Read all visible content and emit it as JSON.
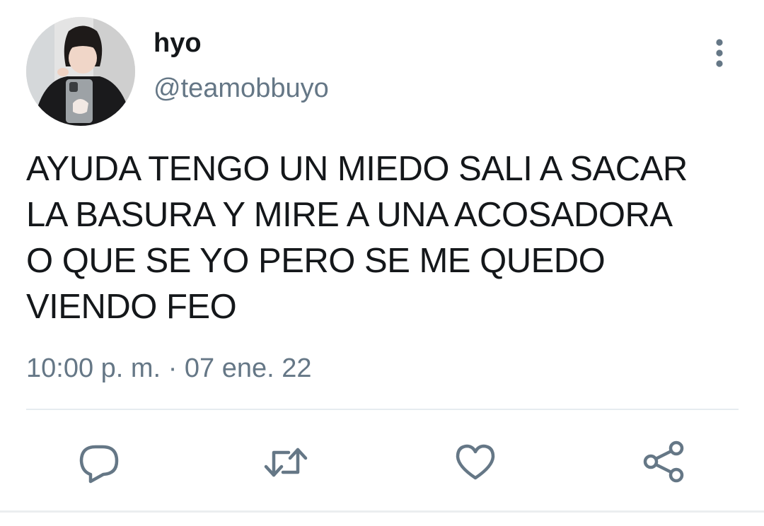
{
  "tweet": {
    "display_name": "hyo",
    "handle": "@teamobbuyo",
    "text": "AYUDA TENGO UN MIEDO SALI A SACAR\nLA BASURA Y MIRE A UNA ACOSADORA\nO QUE SE YO PERO SE ME QUEDO\nVIENDO FEO",
    "time": "10:00 p. m.",
    "separator": "·",
    "date": "07 ene. 22"
  },
  "actions": {
    "reply_icon": "reply-icon",
    "retweet_icon": "retweet-icon",
    "like_icon": "heart-icon",
    "share_icon": "share-icon"
  },
  "colors": {
    "text": "#14171a",
    "secondary": "#657786",
    "icon": "#657786",
    "divider": "#e6ecf0"
  }
}
